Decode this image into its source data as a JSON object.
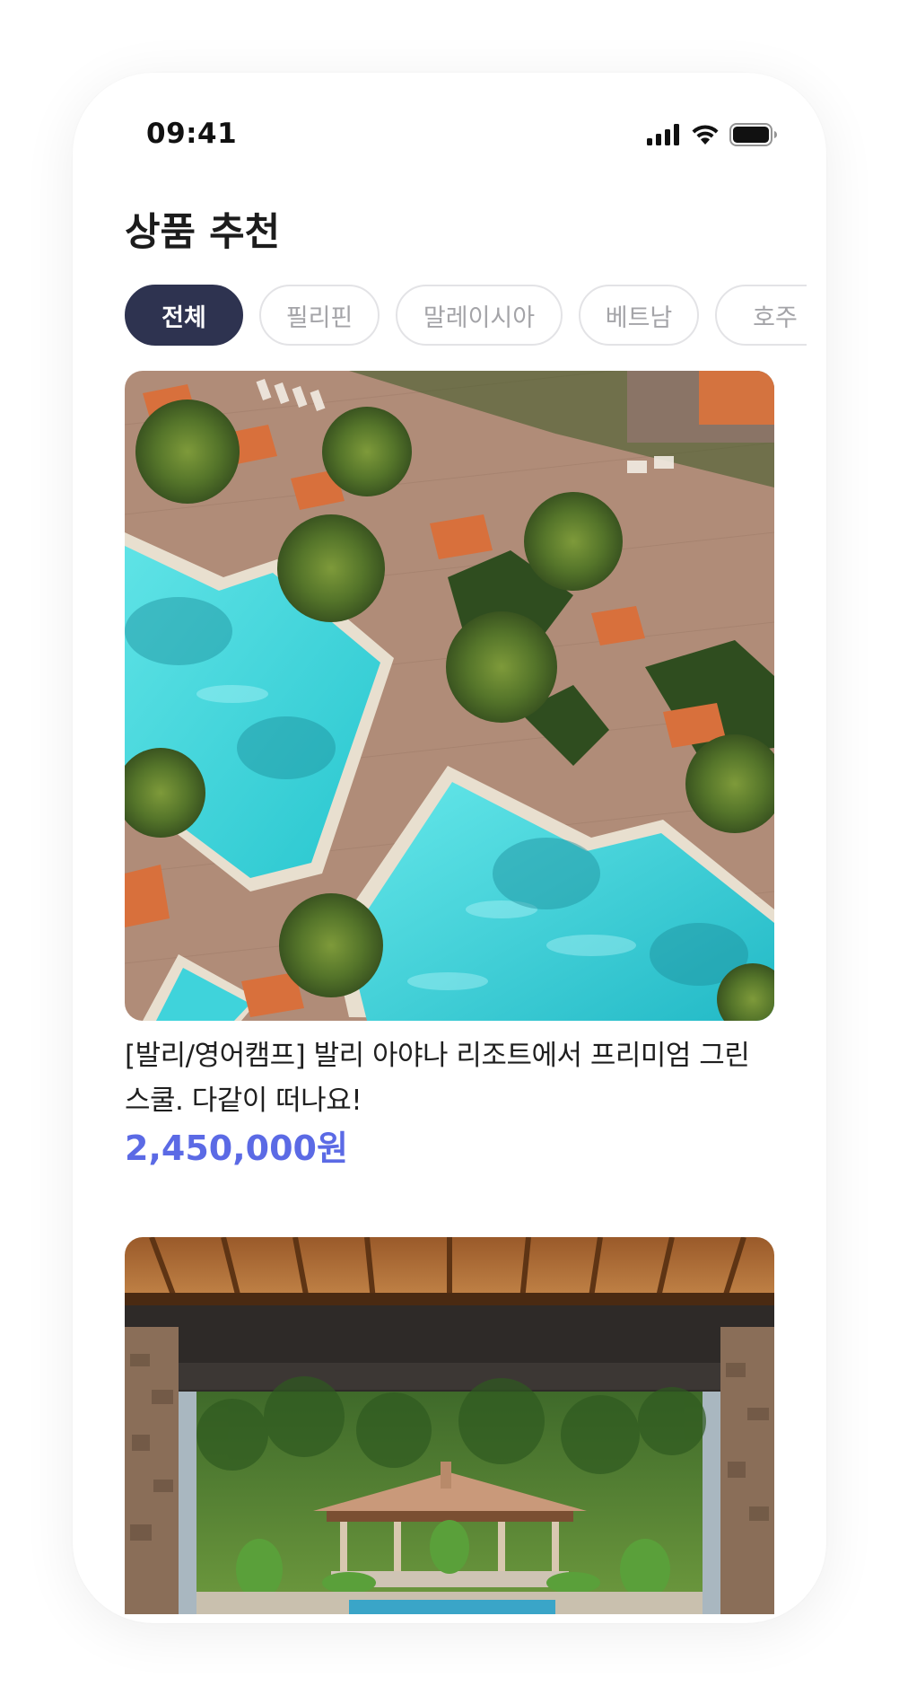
{
  "status_bar": {
    "time": "09:41"
  },
  "header": {
    "title": "상품 추천"
  },
  "filters": {
    "chips": [
      {
        "label": "전체",
        "active": true
      },
      {
        "label": "필리핀",
        "active": false
      },
      {
        "label": "말레이시아",
        "active": false
      },
      {
        "label": "베트남",
        "active": false
      },
      {
        "label": "호주",
        "active": false
      }
    ]
  },
  "products": [
    {
      "image_icon": "resort-pool-aerial-photo",
      "title": "[발리/영어캠프] 발리 아야나 리조트에서 프리미엄 그린스쿨. 다같이 떠나요!",
      "price": "2,450,000원"
    },
    {
      "image_icon": "garden-pavilion-photo"
    }
  ],
  "colors": {
    "chip_active_bg": "#2e3350",
    "price": "#5b6ae5",
    "title": "#1c1c1c"
  }
}
